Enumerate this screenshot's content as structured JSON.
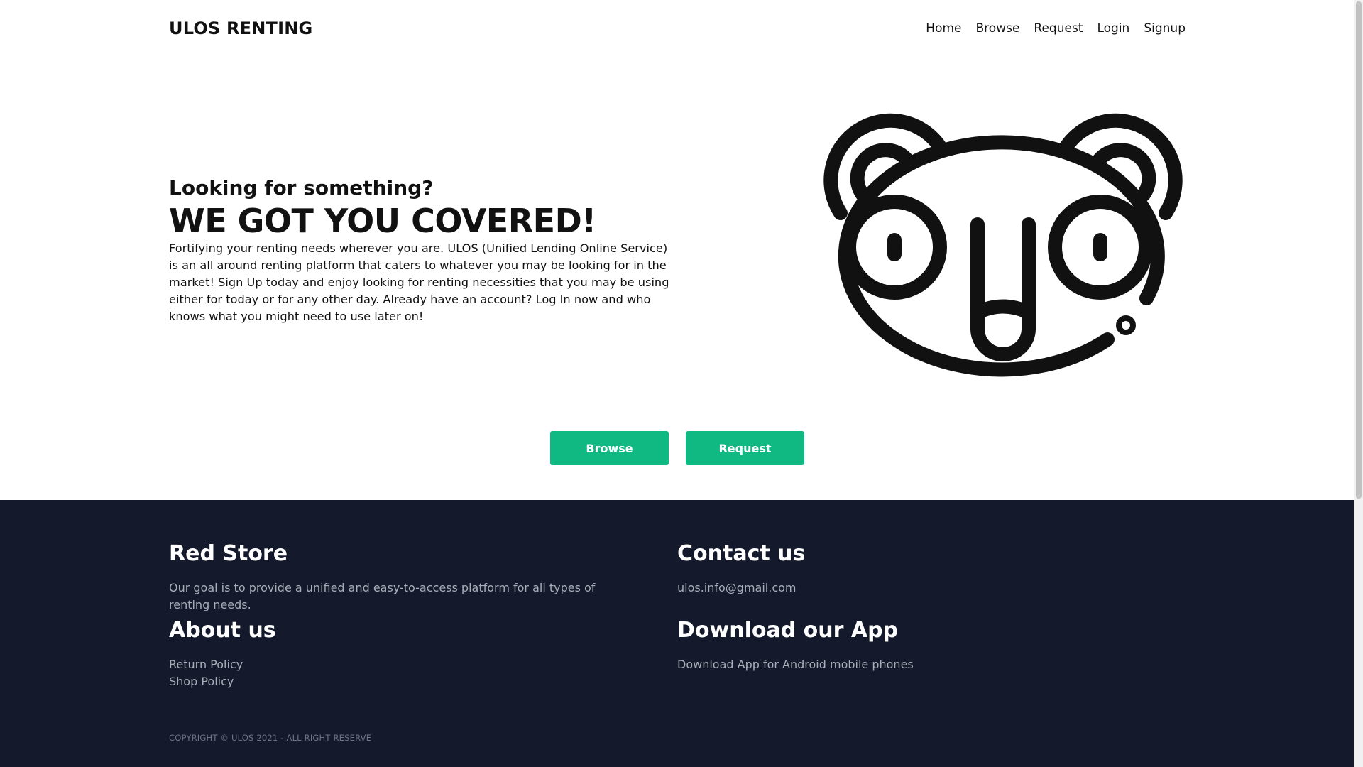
{
  "nav": {
    "brand": "ULOS RENTING",
    "links": [
      "Home",
      "Browse",
      "Request",
      "Login",
      "Signup"
    ]
  },
  "hero": {
    "kicker": "Looking for something?",
    "title": "WE GOT YOU COVERED!",
    "body": "Fortifying your renting needs wherever you are. ULOS (Unified Lending Online Service) is an all around renting platform that caters to whatever you may be looking for in the market! Sign Up today and enjoy looking for renting necessities that you may be using either for today or for any other day. Already have an account? Log In now and who knows what you might need to use later on!",
    "mascot_icon": "koala-mascot-icon"
  },
  "actions": {
    "browse": "Browse",
    "request": "Request",
    "color": "#10b981"
  },
  "footer": {
    "bg_color": "#141a2c",
    "store": {
      "title": "Red Store",
      "text": "Our goal is to provide a unified and easy-to-access platform for all types of renting needs."
    },
    "contact": {
      "title": "Contact us",
      "email": "ulos.info@gmail.com"
    },
    "about": {
      "title": "About us",
      "links": [
        "Return Policy",
        "Shop Policy"
      ]
    },
    "app": {
      "title": "Download our App",
      "text": "Download App for Android mobile phones"
    },
    "copyright": "COPYRIGHT © ULOS 2021 - ALL RIGHT RESERVE"
  }
}
